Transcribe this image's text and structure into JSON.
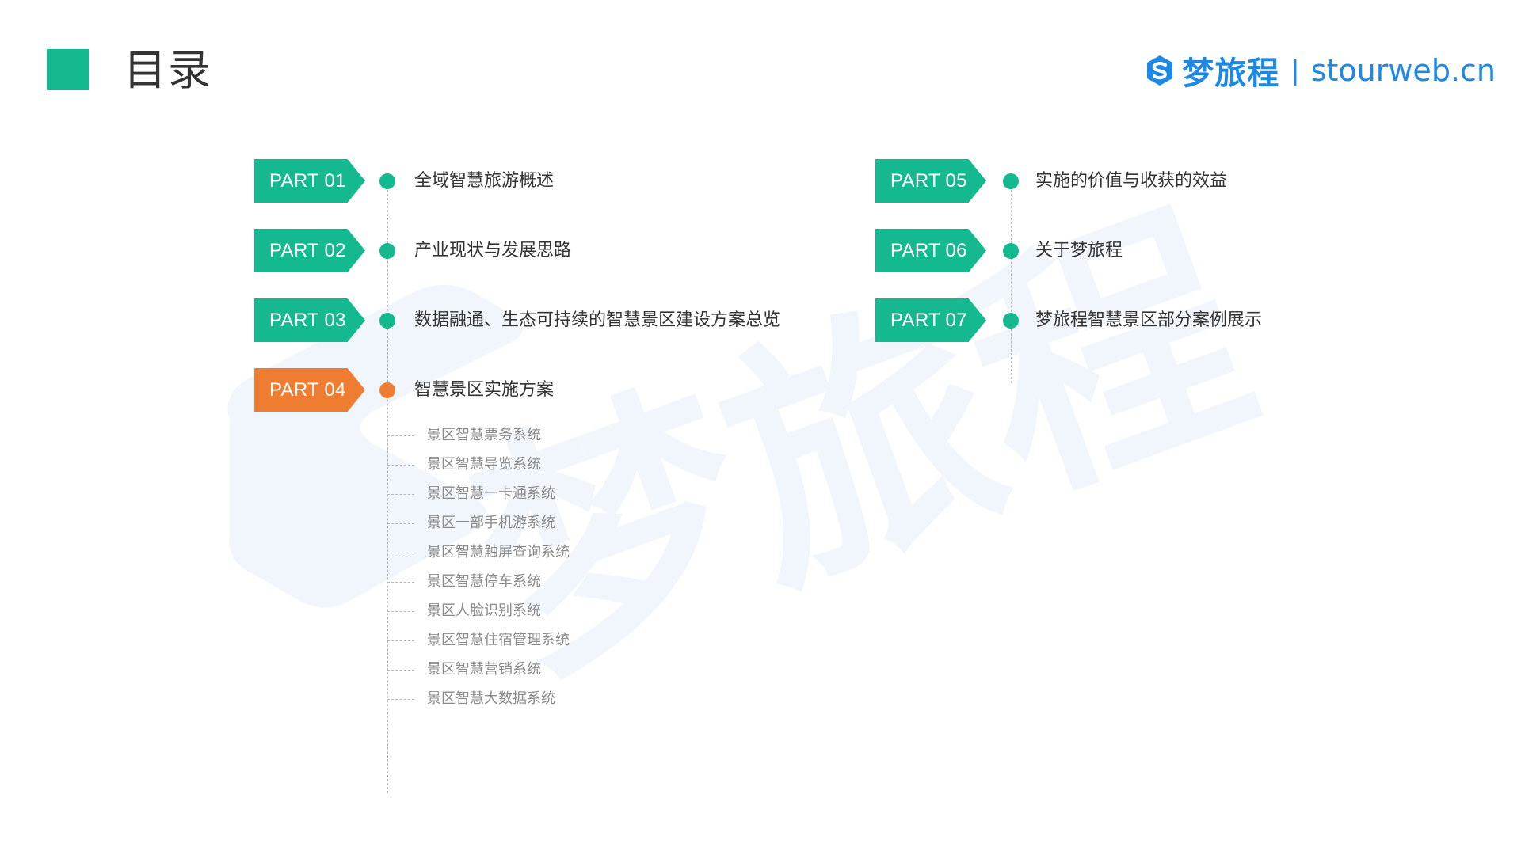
{
  "header": {
    "title": "目录",
    "accent_color": "#14b990"
  },
  "brand": {
    "icon": "s-logo-icon",
    "name": "梦旅程",
    "separator": "|",
    "domain": "stourweb.cn",
    "color": "#1e88e5"
  },
  "watermark": {
    "text": "梦旅程",
    "color": "#eef5fd"
  },
  "colors": {
    "primary": "#14b990",
    "active": "#ef7d31",
    "sub_text": "#8a8a8a"
  },
  "left_parts": [
    {
      "tag": "PART 01",
      "label": "全域智慧旅游概述"
    },
    {
      "tag": "PART 02",
      "label": "产业现状与发展思路"
    },
    {
      "tag": "PART 03",
      "label": "数据融通、生态可持续的智慧景区建设方案总览"
    },
    {
      "tag": "PART 04",
      "label": "智慧景区实施方案",
      "active": true
    }
  ],
  "right_parts": [
    {
      "tag": "PART 05",
      "label": "实施的价值与收获的效益"
    },
    {
      "tag": "PART 06",
      "label": "关于梦旅程"
    },
    {
      "tag": "PART 07",
      "label": "梦旅程智慧景区部分案例展示"
    }
  ],
  "sub_items": [
    "景区智慧票务系统",
    "景区智慧导览系统",
    "景区智慧一卡通系统",
    "景区一部手机游系统",
    "景区智慧触屏查询系统",
    "景区智慧停车系统",
    "景区人脸识别系统",
    "景区智慧住宿管理系统",
    "景区智慧营销系统",
    "景区智慧大数据系统"
  ]
}
